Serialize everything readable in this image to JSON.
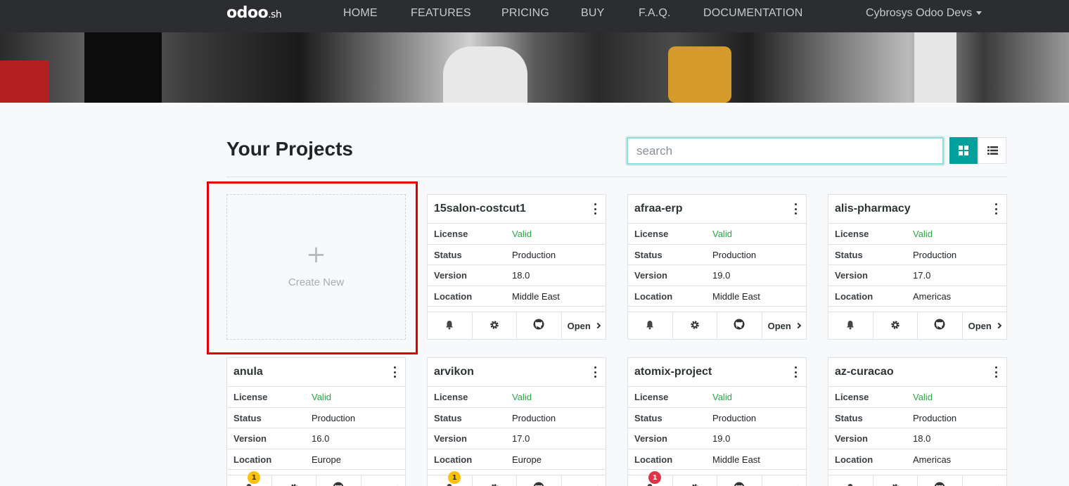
{
  "nav": {
    "logo_main": "odoo",
    "logo_suffix": ".sh",
    "items": [
      "HOME",
      "FEATURES",
      "PRICING",
      "BUY",
      "F.A.Q.",
      "DOCUMENTATION"
    ],
    "user": "Cybrosys Odoo Devs"
  },
  "main": {
    "title": "Your Projects",
    "search_placeholder": "search",
    "create_new_label": "Create New",
    "create_new_plus": "+"
  },
  "labels": {
    "license": "License",
    "status": "Status",
    "version": "Version",
    "location": "Location",
    "open": "Open"
  },
  "projects": [
    {
      "name": "15salon-costcut1",
      "license": "Valid",
      "status": "Production",
      "version": "18.0",
      "location": "Middle East",
      "badge": ""
    },
    {
      "name": "afraa-erp",
      "license": "Valid",
      "status": "Production",
      "version": "19.0",
      "location": "Middle East",
      "badge": ""
    },
    {
      "name": "alis-pharmacy",
      "license": "Valid",
      "status": "Production",
      "version": "17.0",
      "location": "Americas",
      "badge": ""
    },
    {
      "name": "anula",
      "license": "Valid",
      "status": "Production",
      "version": "16.0",
      "location": "Europe",
      "badge": "1"
    },
    {
      "name": "arvikon",
      "license": "Valid",
      "status": "Production",
      "version": "17.0",
      "location": "Europe",
      "badge": "1"
    },
    {
      "name": "atomix-project",
      "license": "Valid",
      "status": "Production",
      "version": "19.0",
      "location": "Middle East",
      "badge": "1"
    },
    {
      "name": "az-curacao",
      "license": "Valid",
      "status": "Production",
      "version": "18.0",
      "location": "Americas",
      "badge": ""
    }
  ],
  "colors": {
    "accent": "#00a09d",
    "valid": "#28a745",
    "navbar": "#2b2d31",
    "highlight": "#e00000"
  }
}
